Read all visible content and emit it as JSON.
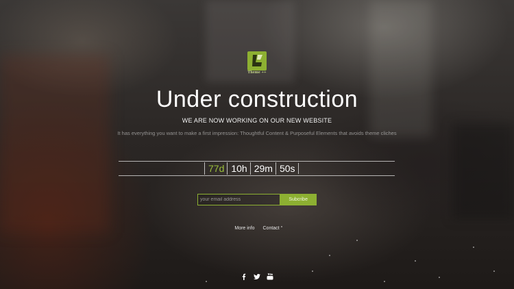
{
  "logo": {
    "icon": "theme-logo-icon",
    "caption": "Theme ++",
    "color": "#8db032"
  },
  "hero": {
    "title": "Under construction",
    "subtitle": "WE ARE NOW WORKING ON OUR NEW WEBSITE",
    "description": "It has everything you want to make a first impression: Thoughtful Content & Purposeful Elements that avoids theme cliches"
  },
  "countdown": {
    "days": "77d",
    "hours": "10h",
    "minutes": "29m",
    "seconds": "50s",
    "accent_color": "#9bbf3b"
  },
  "subscribe": {
    "placeholder": "your email address",
    "button_label": "Subcribe"
  },
  "links": {
    "more_info": "More info",
    "contact": "Contact"
  },
  "social": {
    "icons": [
      "facebook-icon",
      "twitter-icon",
      "youtube-icon"
    ]
  }
}
